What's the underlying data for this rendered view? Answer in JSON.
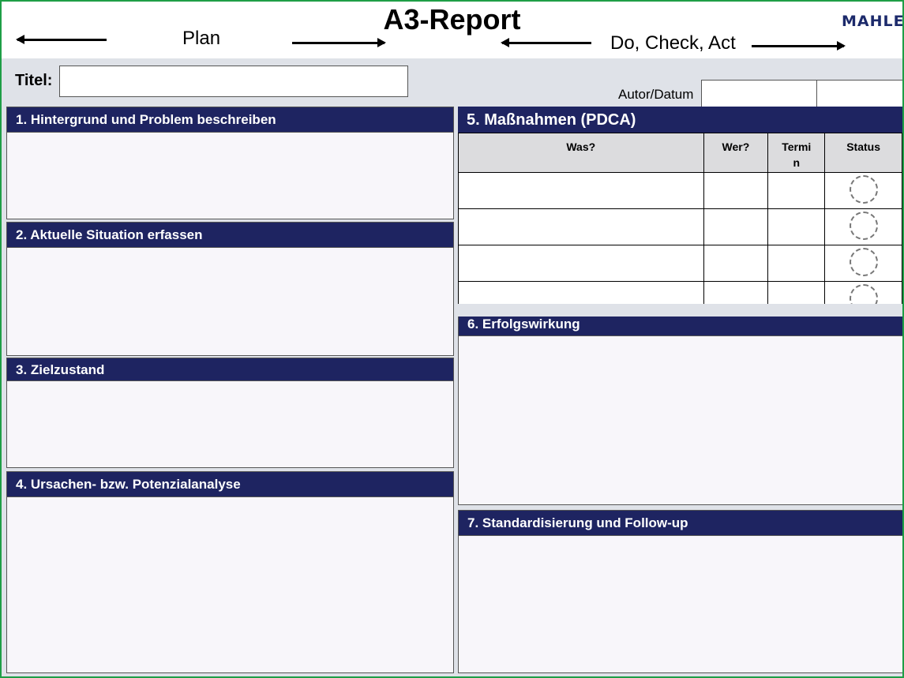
{
  "header": {
    "title": "A3-Report",
    "plan_label": "Plan",
    "dca_label": "Do, Check, Act",
    "logo_text": "MAHLE"
  },
  "meta": {
    "titel_label": "Titel:",
    "titel_value": "",
    "autor_label": "Autor/Datum",
    "autor_value": "",
    "datum_value": ""
  },
  "sections": {
    "s1": "1. Hintergrund und Problem beschreiben",
    "s2": "2. Aktuelle Situation erfassen",
    "s3": "3. Zielzustand",
    "s4": "4. Ursachen- bzw. Potenzialanalyse",
    "s5": "5. Maßnahmen (PDCA)",
    "s6": "6. Erfolgswirkung",
    "s7": "7. Standardisierung und Follow-up"
  },
  "pdca_table": {
    "headers": [
      "Was?",
      "Wer?",
      "Termi n",
      "Status"
    ],
    "rows": [
      [
        "",
        "",
        "",
        ""
      ],
      [
        "",
        "",
        "",
        ""
      ],
      [
        "",
        "",
        "",
        ""
      ],
      [
        "",
        "",
        "",
        ""
      ]
    ]
  },
  "colors": {
    "header_bar": "#1e2461",
    "frame_border": "#1e9e46",
    "background": "#dfe2e8"
  }
}
